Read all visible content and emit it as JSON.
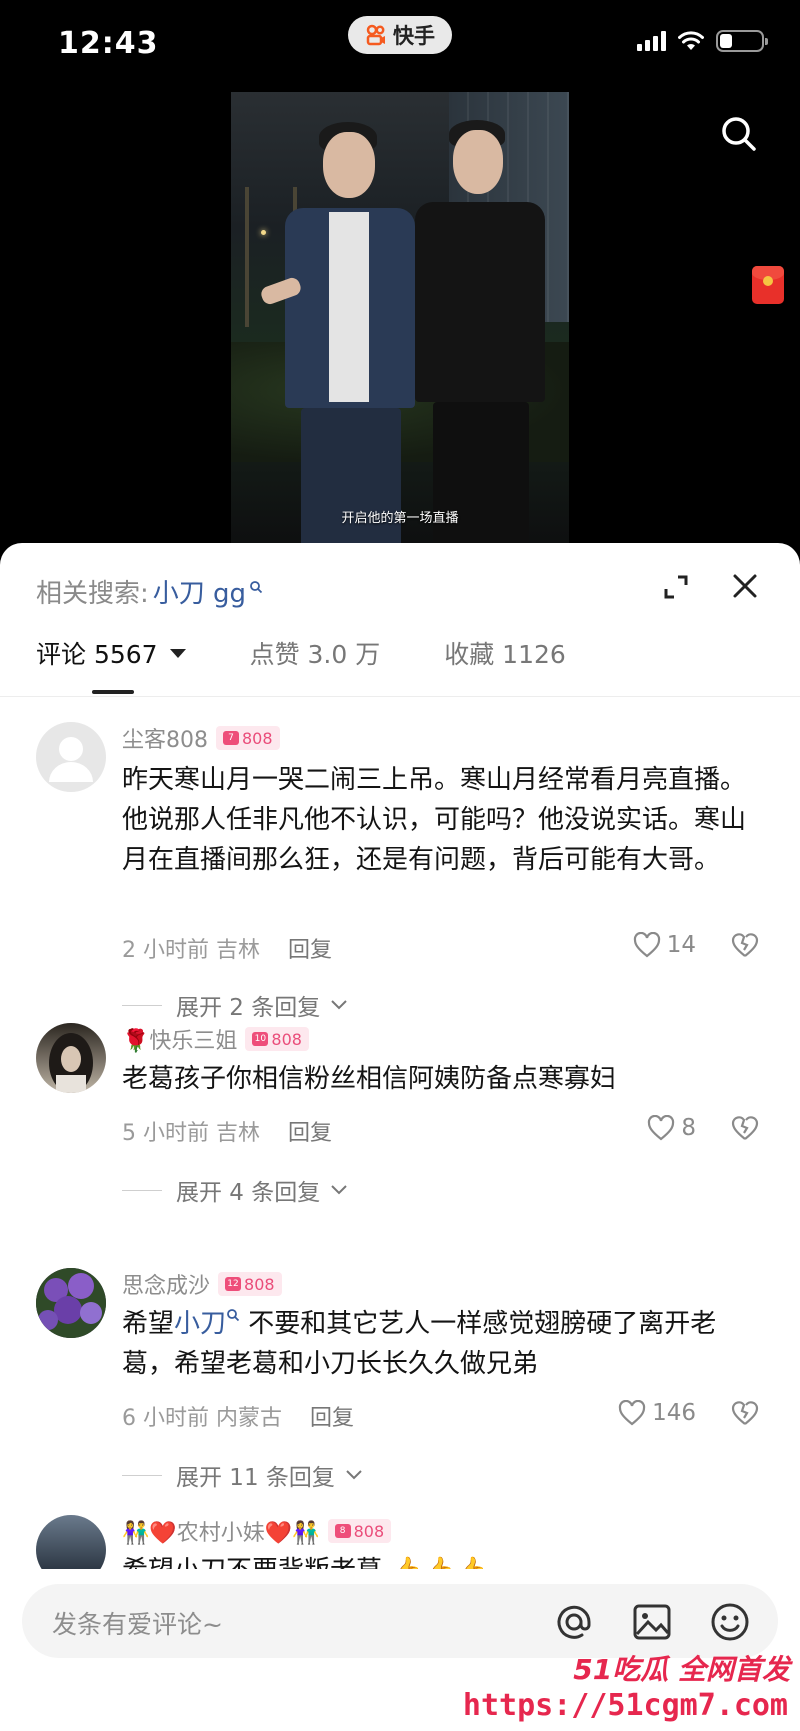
{
  "status_bar": {
    "time": "12:43",
    "app_name": "快手"
  },
  "video": {
    "subtitle": "开启他的第一场直播"
  },
  "sheet": {
    "related_label": "相关搜索:",
    "related_keyword": "小刀 gg",
    "tabs": [
      {
        "label": "评论 5567",
        "active": true
      },
      {
        "label": "点赞 3.0 万",
        "active": false
      },
      {
        "label": "收藏 1126",
        "active": false
      }
    ],
    "comments": [
      {
        "name": "尘客808",
        "badge": "808",
        "badge_level": "7",
        "text": "昨天寒山月一哭二闹三上吊。寒山月经常看月亮直播。他说那人任非凡他不认识，可能吗？他没说实话。寒山月在直播间那么狂，还是有问题，背后可能有大哥。",
        "time": "2 小时前",
        "location": "吉林",
        "reply_label": "回复",
        "likes": "14",
        "expand": "展开 2 条回复"
      },
      {
        "name": "🌹快乐三姐",
        "badge": "808",
        "badge_level": "10",
        "text": "老葛孩子你相信粉丝相信阿姨防备点寒寡妇",
        "time": "5 小时前",
        "location": "吉林",
        "reply_label": "回复",
        "likes": "8",
        "expand": "展开 4 条回复"
      },
      {
        "name": "思念成沙",
        "badge": "808",
        "badge_level": "12",
        "text_prefix": "希望",
        "text_keyword": "小刀",
        "text_suffix": " 不要和其它艺人一样感觉翅膀硬了离开老葛，希望老葛和小刀长长久久做兄弟",
        "time": "6 小时前",
        "location": "内蒙古",
        "reply_label": "回复",
        "likes": "146",
        "expand": "展开 11 条回复"
      },
      {
        "name": "👫❤️农村小妹❤️👫",
        "badge": "808",
        "badge_level": "8",
        "text": "希望小刀不要背叛老葛 👍👍👍"
      }
    ],
    "input_placeholder": "发条有爱评论~"
  },
  "watermark": {
    "line1": "51吃瓜 全网首发",
    "line2": "https://51cgm7.com"
  },
  "colors": {
    "accent_link": "#385d9e",
    "badge_pink": "#ea4d7a",
    "watermark_red": "#e6274e"
  }
}
